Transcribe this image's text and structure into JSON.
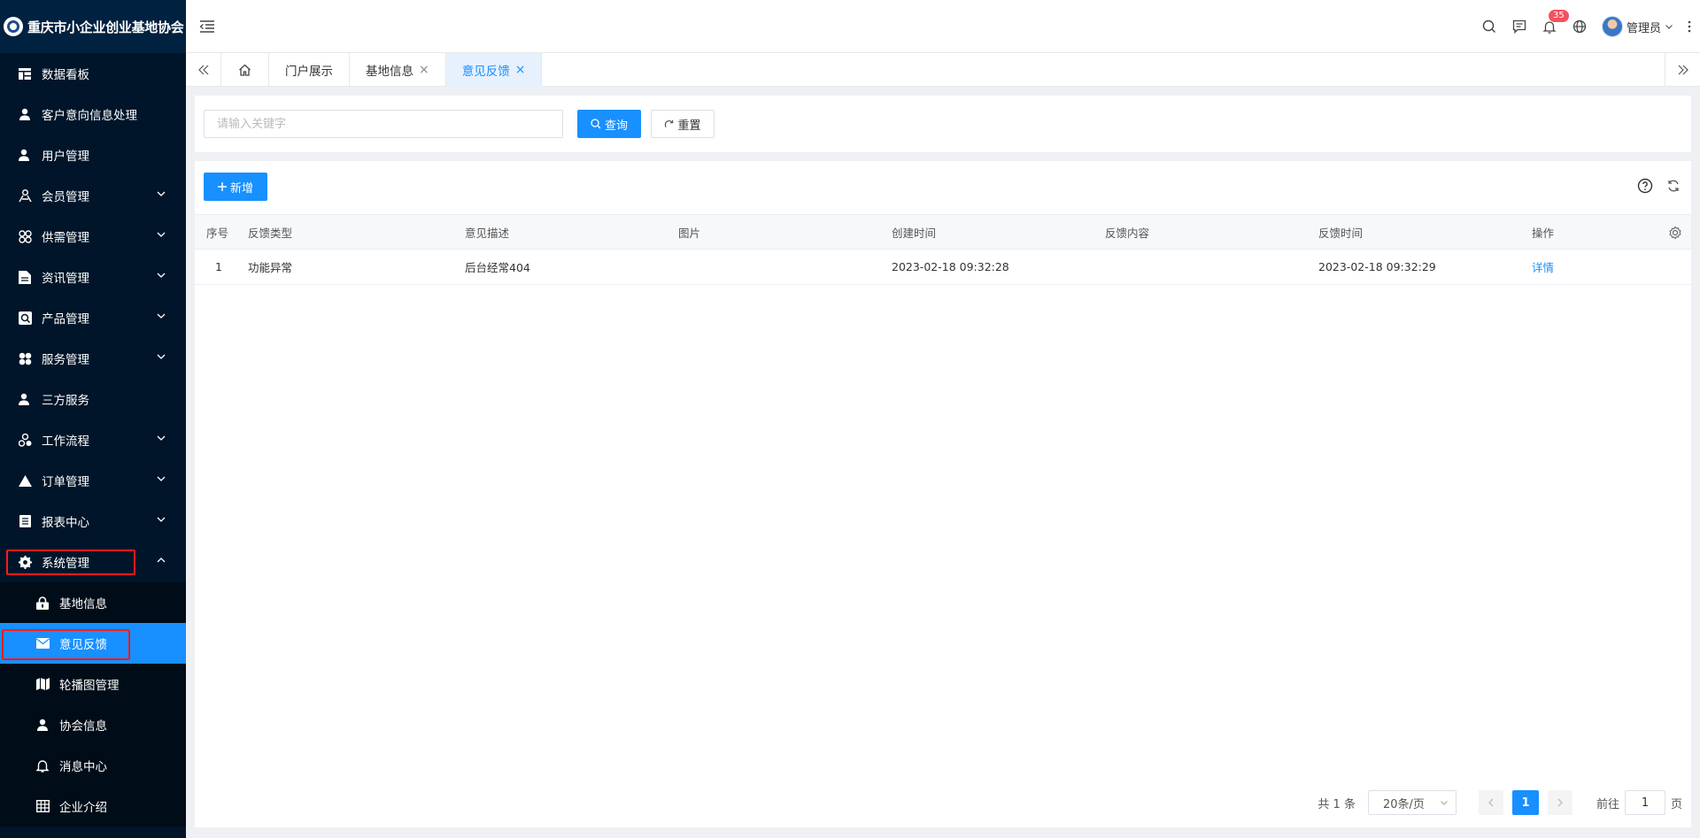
{
  "app": {
    "title": "重庆市小企业创业基地协会"
  },
  "sidebar": {
    "items": [
      {
        "label": "数据看板",
        "icon": "dashboard-icon"
      },
      {
        "label": "客户意向信息处理",
        "icon": "user-icon"
      },
      {
        "label": "用户管理",
        "icon": "user-icon"
      },
      {
        "label": "会员管理",
        "icon": "members-icon"
      },
      {
        "label": "供需管理",
        "icon": "clover-icon"
      },
      {
        "label": "资讯管理",
        "icon": "document-icon"
      },
      {
        "label": "产品管理",
        "icon": "search-icon"
      },
      {
        "label": "服务管理",
        "icon": "grid-icon"
      },
      {
        "label": "三方服务",
        "icon": "user-icon"
      },
      {
        "label": "工作流程",
        "icon": "workflow-icon"
      },
      {
        "label": "订单管理",
        "icon": "triangle-icon"
      },
      {
        "label": "报表中心",
        "icon": "report-icon"
      },
      {
        "label": "系统管理",
        "icon": "gear-icon"
      }
    ],
    "sub_items": [
      {
        "label": "基地信息",
        "icon": "lock-icon"
      },
      {
        "label": "意见反馈",
        "icon": "mail-icon"
      },
      {
        "label": "轮播图管理",
        "icon": "map-icon"
      },
      {
        "label": "协会信息",
        "icon": "user-icon"
      },
      {
        "label": "消息中心",
        "icon": "bell-icon"
      },
      {
        "label": "企业介绍",
        "icon": "table-icon"
      }
    ]
  },
  "header": {
    "notification_count": "35",
    "user_name": "管理员"
  },
  "tabs": [
    {
      "label": "门户展示",
      "closable": false
    },
    {
      "label": "基地信息",
      "closable": true
    },
    {
      "label": "意见反馈",
      "closable": true
    }
  ],
  "tab_close_symbol": "×",
  "search": {
    "placeholder": "请输入关键字",
    "query_label": "查询",
    "reset_label": "重置"
  },
  "toolbar": {
    "add_label": "新增"
  },
  "table": {
    "columns": [
      "序号",
      "反馈类型",
      "意见描述",
      "图片",
      "创建时间",
      "反馈内容",
      "反馈时间",
      "操作"
    ],
    "rows": [
      {
        "index": "1",
        "type": "功能异常",
        "description": "后台经常404",
        "image": "",
        "created": "2023-02-18 09:32:28",
        "content": "",
        "feedback_time": "2023-02-18 09:32:29",
        "action": "详情"
      }
    ]
  },
  "pagination": {
    "total": "共 1 条",
    "page_size": "20条/页",
    "current_page": "1",
    "goto_label": "前往",
    "goto_value": "1",
    "page_unit": "页"
  },
  "colors": {
    "sidebar_bg": "#001529",
    "primary": "#1890ff",
    "highlight_border": "#ff1a1a",
    "badge": "#f5515f"
  }
}
